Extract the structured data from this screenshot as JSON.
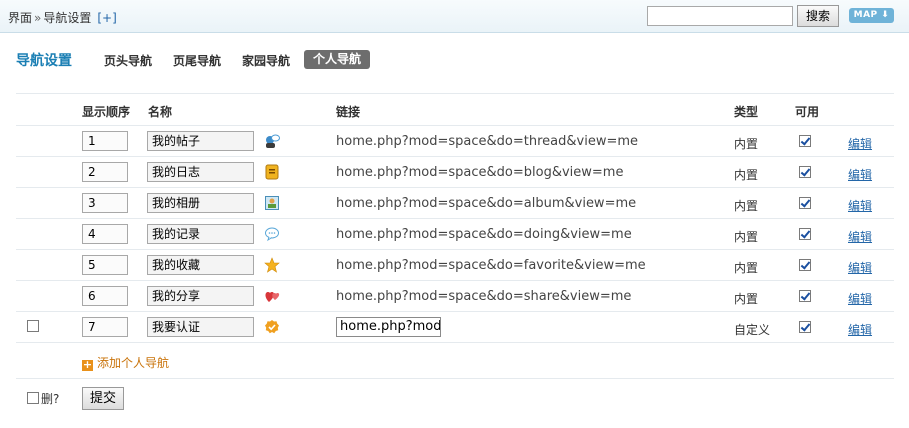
{
  "breadcrumb": {
    "part1": "界面",
    "sep": "»",
    "part2": "导航设置",
    "add": "[+]"
  },
  "search": {
    "value": "",
    "button": "搜索",
    "map": "MAP ⬇"
  },
  "section": {
    "title": "导航设置"
  },
  "tabs": [
    {
      "label": "页头导航"
    },
    {
      "label": "页尾导航"
    },
    {
      "label": "家园导航"
    },
    {
      "label": "个人导航",
      "active": true
    }
  ],
  "columns": {
    "order": "显示顺序",
    "name": "名称",
    "link": "链接",
    "type": "类型",
    "available": "可用"
  },
  "rows": [
    {
      "order": "1",
      "name": "我的帖子",
      "icon": "thread-icon",
      "link": "home.php?mod=space&do=thread&view=me",
      "type": "内置",
      "enabled": true,
      "edit": "编辑"
    },
    {
      "order": "2",
      "name": "我的日志",
      "icon": "blog-icon",
      "link": "home.php?mod=space&do=blog&view=me",
      "type": "内置",
      "enabled": true,
      "edit": "编辑"
    },
    {
      "order": "3",
      "name": "我的相册",
      "icon": "album-icon",
      "link": "home.php?mod=space&do=album&view=me",
      "type": "内置",
      "enabled": true,
      "edit": "编辑"
    },
    {
      "order": "4",
      "name": "我的记录",
      "icon": "doing-icon",
      "link": "home.php?mod=space&do=doing&view=me",
      "type": "内置",
      "enabled": true,
      "edit": "编辑"
    },
    {
      "order": "5",
      "name": "我的收藏",
      "icon": "favorite-icon",
      "link": "home.php?mod=space&do=favorite&view=me",
      "type": "内置",
      "enabled": true,
      "edit": "编辑"
    },
    {
      "order": "6",
      "name": "我的分享",
      "icon": "share-icon",
      "link": "home.php?mod=space&do=share&view=me",
      "type": "内置",
      "enabled": true,
      "edit": "编辑"
    },
    {
      "order": "7",
      "name": "我要认证",
      "icon": "verify-icon",
      "link": "home.php?mod",
      "type": "自定义",
      "enabled": true,
      "edit": "编辑",
      "editable_link": true
    }
  ],
  "add_label": "添加个人导航",
  "footer": {
    "delete_label": "删?",
    "submit": "提交"
  },
  "colors": {
    "accent": "#1b7fb4",
    "link": "#2366a8",
    "add": "#c9730a"
  }
}
